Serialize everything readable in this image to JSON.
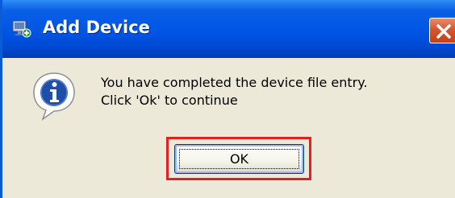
{
  "window": {
    "title": "Add Device",
    "title_icon": "device-app-icon",
    "close_icon": "close-icon"
  },
  "message": {
    "icon": "info-icon",
    "line1": "You have completed the device file entry.",
    "line2": "Click 'Ok' to continue"
  },
  "buttons": {
    "ok_label": "OK"
  },
  "colors": {
    "titlebar": "#0055E5",
    "dialog_background": "#ECE9D8",
    "close_button": "#D7562E",
    "highlight_outline": "#E51F1F",
    "info_icon": "#1F4FA8"
  }
}
